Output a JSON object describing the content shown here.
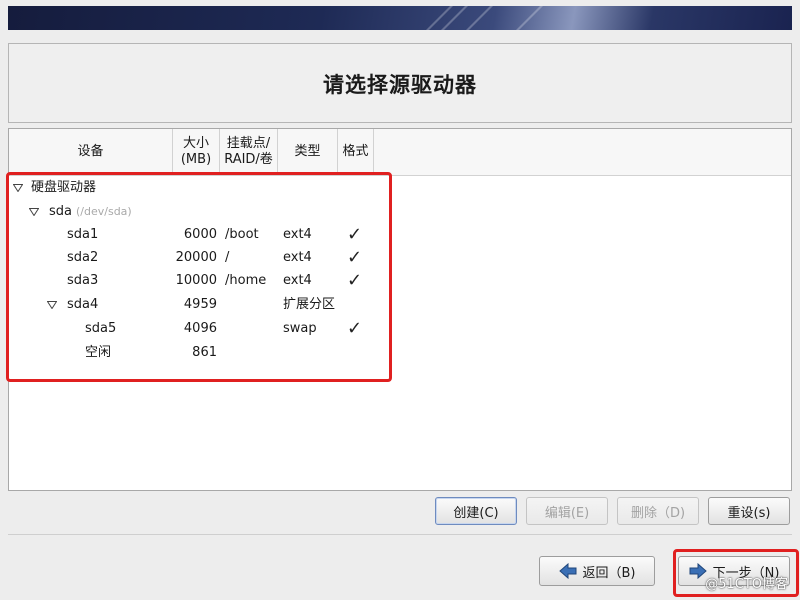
{
  "header": {
    "title": "请选择源驱动器"
  },
  "table": {
    "columns": {
      "device": "设备",
      "size_line1": "大小",
      "size_line2": "(MB)",
      "mount_line1": "挂载点/",
      "mount_line2": "RAID/卷",
      "type": "类型",
      "format": "格式"
    },
    "rows": [
      {
        "device": "硬盘驱动器"
      },
      {
        "device": "sda",
        "path": "(/dev/sda)"
      },
      {
        "device": "sda1",
        "size": "6000",
        "mount": "/boot",
        "type": "ext4",
        "format": "✓"
      },
      {
        "device": "sda2",
        "size": "20000",
        "mount": "/",
        "type": "ext4",
        "format": "✓"
      },
      {
        "device": "sda3",
        "size": "10000",
        "mount": "/home",
        "type": "ext4",
        "format": "✓"
      },
      {
        "device": "sda4",
        "size": "4959",
        "mount": "",
        "type": "扩展分区",
        "format": ""
      },
      {
        "device": "sda5",
        "size": "4096",
        "mount": "",
        "type": "swap",
        "format": "✓"
      },
      {
        "device": "空闲",
        "size": "861",
        "mount": "",
        "type": "",
        "format": ""
      }
    ]
  },
  "actions": {
    "create": "创建(C)",
    "edit": "编辑(E)",
    "delete": "删除（D)",
    "reset": "重设(s)"
  },
  "nav": {
    "back": "返回（B)",
    "next": "下一步（N)"
  },
  "watermark": "@51CTO博客",
  "colors": {
    "highlight": "#e02020",
    "banner": "#1e2a55"
  }
}
